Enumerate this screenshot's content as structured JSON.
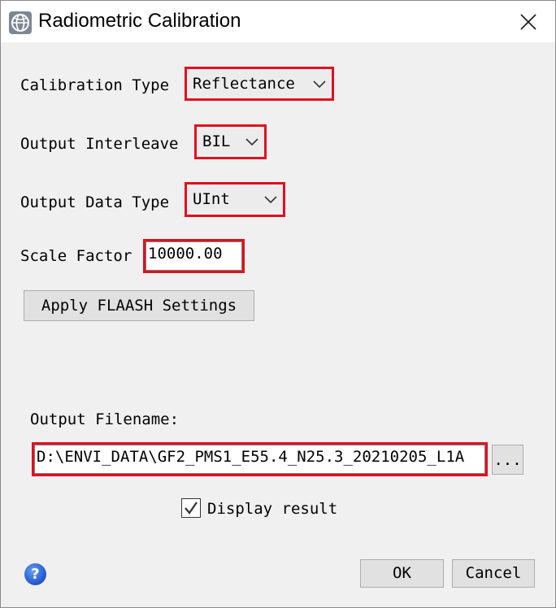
{
  "window": {
    "title": "Radiometric Calibration",
    "app_icon": "envi-globe-icon",
    "close_icon": "close-icon"
  },
  "form": {
    "calibration_type": {
      "label": "Calibration Type",
      "value": "Reflectance"
    },
    "output_interleave": {
      "label": "Output Interleave",
      "value": "BIL"
    },
    "output_data_type": {
      "label": "Output Data Type",
      "value": "UInt"
    },
    "scale_factor": {
      "label": "Scale Factor",
      "value": "10000.00"
    },
    "apply_flaash_button": "Apply FLAASH Settings",
    "output_filename": {
      "label": "Output Filename:",
      "value": "D:\\ENVI_DATA\\GF2_PMS1_E55.4_N25.3_20210205_L1A",
      "browse_label": "..."
    },
    "display_result": {
      "label": "Display result",
      "checked": true
    }
  },
  "footer": {
    "help_icon": "help-icon",
    "help_glyph": "?",
    "ok_label": "OK",
    "cancel_label": "Cancel"
  },
  "colors": {
    "highlight": "#e01020",
    "dialog_bg": "#f0f0f0",
    "titlebar_bg": "#ffffff"
  }
}
